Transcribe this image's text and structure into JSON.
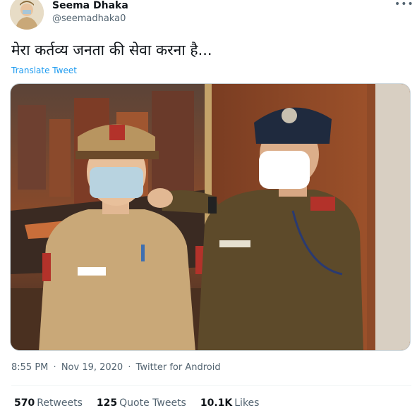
{
  "header": {
    "display_name": "Seema Dhaka",
    "handle": "@seemadhaka0",
    "more_icon": "more-options-icon"
  },
  "tweet": {
    "text": "मेरा कर्तव्य जनता की सेवा करना है...",
    "translate_label": "Translate Tweet",
    "media_name_tag_right": "E.S.SHARMA"
  },
  "meta": {
    "time": "8:55 PM",
    "date": "Nov 19, 2020",
    "source": "Twitter for Android"
  },
  "stats": {
    "retweets_count": "570",
    "retweets_label": "Retweets",
    "quotes_count": "125",
    "quotes_label": "Quote Tweets",
    "likes_count": "10.1K",
    "likes_label": "Likes"
  },
  "colors": {
    "link": "#1d9bf0",
    "secondary_text": "#536471",
    "uniform_khaki": "#c9a878",
    "uniform_dark": "#5d4a2a"
  }
}
